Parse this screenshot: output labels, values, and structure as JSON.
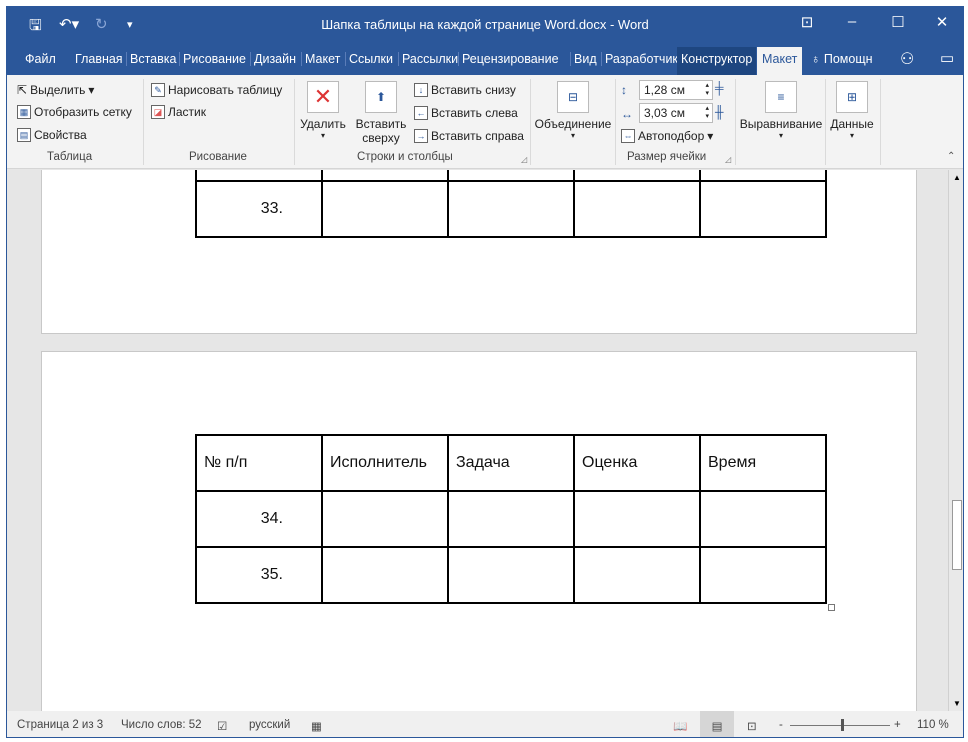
{
  "window": {
    "title": "Шапка таблицы на каждой странице Word.docx  -  Word"
  },
  "tabs": [
    "Файл",
    "Главная",
    "Вставка",
    "Рисование",
    "Дизайн",
    "Макет",
    "Ссылки",
    "Рассылки",
    "Рецензирование",
    "Вид",
    "Разработчик",
    "Конструктор",
    "Макет"
  ],
  "help": "Помощн",
  "ribbon": {
    "table": {
      "select": "Выделить",
      "grid": "Отобразить сетку",
      "props": "Свойства",
      "label": "Таблица"
    },
    "draw": {
      "draw_table": "Нарисовать таблицу",
      "eraser": "Ластик",
      "label": "Рисование"
    },
    "rows": {
      "delete": "Удалить",
      "insert_above_1": "Вставить",
      "insert_above_2": "сверху",
      "below": "Вставить снизу",
      "left": "Вставить слева",
      "right": "Вставить справа",
      "label": "Строки и столбцы"
    },
    "merge": "Объединение",
    "cellsize": {
      "height": "1,28 см",
      "width": "3,03 см",
      "autofit": "Автоподбор",
      "label": "Размер ячейки"
    },
    "align": "Выравнивание",
    "data": "Данные"
  },
  "doc": {
    "top_rows": [
      [
        "33.",
        "",
        "",
        "",
        ""
      ]
    ],
    "header": [
      "№ п/п",
      "Исполнитель",
      "Задача",
      "Оценка",
      "Время"
    ],
    "rows": [
      [
        "34.",
        "",
        "",
        "",
        ""
      ],
      [
        "35.",
        "",
        "",
        "",
        ""
      ]
    ]
  },
  "status": {
    "page": "Страница 2 из 3",
    "words": "Число слов: 52",
    "lang": "русский",
    "zoom": "110 %",
    "zoom_fraction": 0.52
  },
  "colors": {
    "accent": "#2b579a"
  }
}
